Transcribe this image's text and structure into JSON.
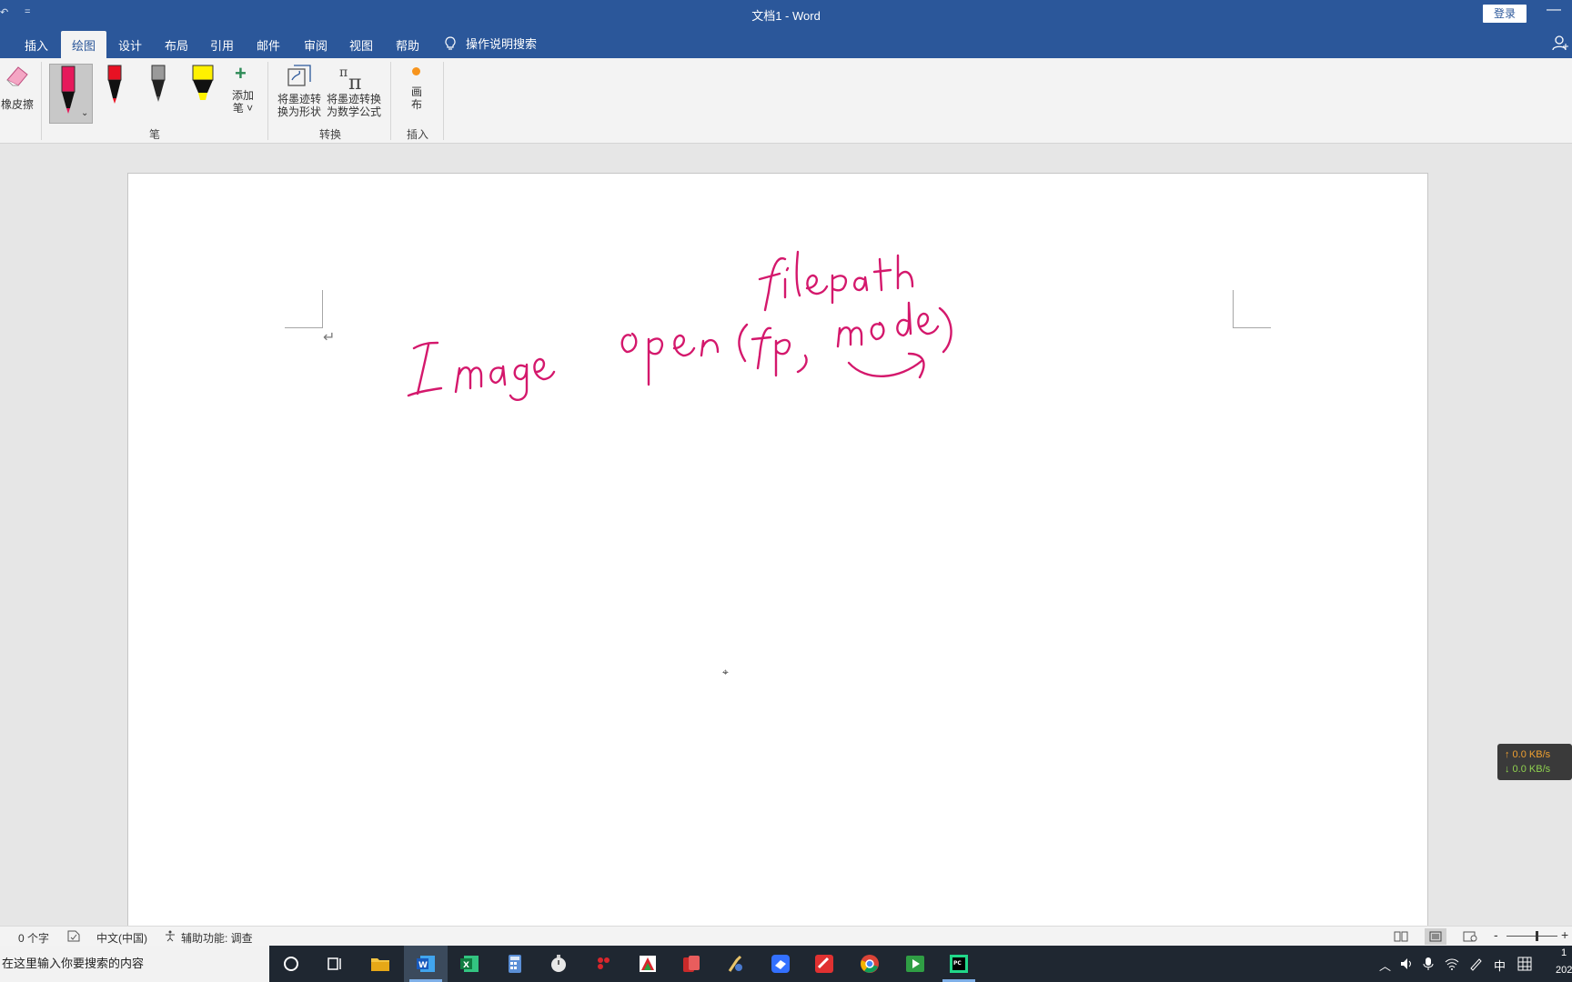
{
  "window": {
    "title": "文档1  -  Word",
    "signin_label": "登录",
    "minimize_glyph": "—"
  },
  "quick_access": {
    "undo_glyph": "↶",
    "customize_glyph": "="
  },
  "ribbon_tabs": [
    {
      "label": "插入",
      "active": false
    },
    {
      "label": "绘图",
      "active": true
    },
    {
      "label": "设计",
      "active": false
    },
    {
      "label": "布局",
      "active": false
    },
    {
      "label": "引用",
      "active": false
    },
    {
      "label": "邮件",
      "active": false
    },
    {
      "label": "审阅",
      "active": false
    },
    {
      "label": "视图",
      "active": false
    },
    {
      "label": "帮助",
      "active": false
    }
  ],
  "tell_me": {
    "label": "操作说明搜索",
    "icon": "lightbulb-icon"
  },
  "ribbon": {
    "eraser_label": "橡皮擦",
    "add_pen_label_1": "添加",
    "add_pen_label_2": "笔 ˅",
    "group_pens": "笔",
    "ink_to_shape_1": "将墨迹转",
    "ink_to_shape_2": "换为形状",
    "ink_to_math_1": "将墨迹转换",
    "ink_to_math_2": "为数学公式",
    "group_convert": "转换",
    "canvas_label_1": "画",
    "canvas_label_2": "布",
    "group_insert": "插入",
    "pens": [
      {
        "name": "pink-pen",
        "color": "#e6195b",
        "selected": true
      },
      {
        "name": "red-pen",
        "color": "#e81123",
        "selected": false
      },
      {
        "name": "pencil",
        "color": "#7a7a7a",
        "selected": false
      },
      {
        "name": "highlighter",
        "color": "#fff100",
        "selected": false
      }
    ]
  },
  "document": {
    "ink_color": "#d4186c",
    "paragraph_mark": "↵",
    "ink_words": [
      "filepath",
      "Image",
      "open(fp, mode)"
    ]
  },
  "net_speed": {
    "up": "↑ 0.0 KB/s",
    "down": "↓ 0.0 KB/s"
  },
  "status_bar": {
    "word_count": "0 个字",
    "language": "中文(中国)",
    "accessibility": "辅助功能: 调查",
    "zoom_minus": "-",
    "zoom_plus": "+"
  },
  "taskbar": {
    "search_placeholder": "在这里输入你要搜索的内容",
    "ime": "中",
    "clock_top": "1",
    "clock_bottom": "202"
  }
}
